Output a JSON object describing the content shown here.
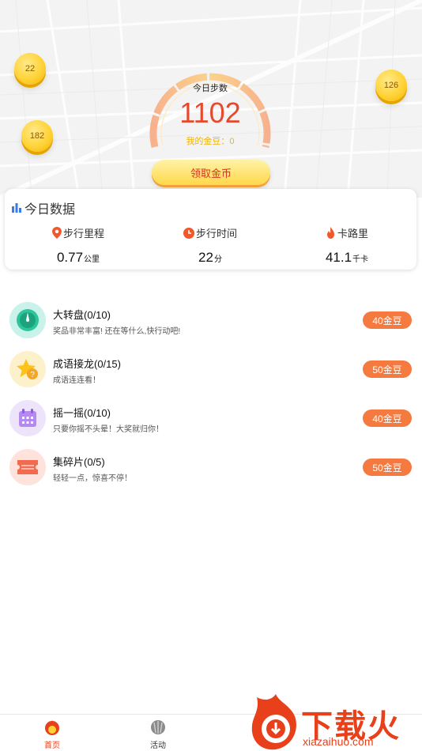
{
  "header": {
    "coins": [
      {
        "value": "22"
      },
      {
        "value": "182"
      },
      {
        "value": "126"
      }
    ],
    "steps_title": "今日步数",
    "steps_value": "1102",
    "beans_text": "我的金豆：0",
    "claim_label": "领取金币"
  },
  "today": {
    "title": "今日数据",
    "stats": [
      {
        "label": "步行里程",
        "value": "0.77",
        "unit": "公里",
        "icon": "location-pin-icon"
      },
      {
        "label": "步行时间",
        "value": "22",
        "unit": "分",
        "icon": "clock-icon"
      },
      {
        "label": "卡路里",
        "value": "41.1",
        "unit": "千卡",
        "icon": "flame-icon"
      }
    ]
  },
  "tasks": [
    {
      "name": "大转盘(0/10)",
      "desc": "奖品非常丰富! 还在等什么,快行动吧!",
      "reward": "40金豆",
      "icon": "wheel-icon",
      "color": "#c9f3ea"
    },
    {
      "name": "成语接龙(0/15)",
      "desc": "成语连连看！",
      "reward": "50金豆",
      "icon": "star-question-icon",
      "color": "#fdf1cc"
    },
    {
      "name": "摇一摇(0/10)",
      "desc": "只要你摇不头晕！大奖就归你！",
      "reward": "40金豆",
      "icon": "calendar-icon",
      "color": "#ede3fb"
    },
    {
      "name": "集碎片(0/5)",
      "desc": "轻轻一点，惊喜不停！",
      "reward": "50金豆",
      "icon": "ticket-icon",
      "color": "#fde3dc"
    }
  ],
  "nav": {
    "items": [
      {
        "label": "首页",
        "icon": "home-bird-icon",
        "active": true
      },
      {
        "label": "活动",
        "icon": "activity-shell-icon",
        "active": false
      }
    ]
  },
  "watermark": {
    "text": "下载火",
    "url": "xiazaihuo.com"
  },
  "colors": {
    "accent": "#e64a2e",
    "reward": "#f57a40",
    "gold": "#ffd338"
  }
}
